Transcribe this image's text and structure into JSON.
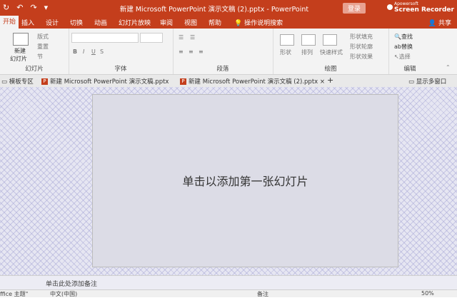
{
  "titlebar": {
    "title": "新建 Microsoft PowerPoint 演示文稿 (2).pptx  -  PowerPoint",
    "login": "登录",
    "recorder_line1": "Apowersoft",
    "recorder_line2": "Screen Recorder"
  },
  "tabs": [
    "开始",
    "插入",
    "设计",
    "切换",
    "动画",
    "幻灯片放映",
    "审阅",
    "视图",
    "帮助",
    "操作说明搜索"
  ],
  "share": "共享",
  "ribbon": {
    "slides": {
      "new_slide": "新建",
      "new_slide2": "幻灯片",
      "layout": "版式",
      "reset": "重置",
      "section": "节",
      "label": "幻灯片"
    },
    "font": {
      "label": "字体"
    },
    "paragraph": {
      "label": "段落"
    },
    "drawing": {
      "shape": "形状",
      "arrange": "排列",
      "quick_styles": "快速样式",
      "fill": "形状填充",
      "outline": "形状轮廓",
      "effects": "形状效果",
      "label": "绘图"
    },
    "editing": {
      "find": "查找",
      "replace": "替换",
      "select": "选择",
      "label": "编辑"
    }
  },
  "doctabs": {
    "template": "模板专区",
    "tab1": "新建 Microsoft PowerPoint 演示文稿.pptx",
    "tab2": "新建 Microsoft PowerPoint 演示文稿 (2).pptx",
    "add": "+",
    "show_window": "显示多窗口"
  },
  "slide": {
    "placeholder": "单击以添加第一张幻灯片"
  },
  "notes": {
    "placeholder": "单击此处添加备注"
  },
  "status": {
    "office": "ffice 主题\"",
    "lang": "中文(中国)",
    "notes": "备注",
    "zoom": "50%"
  },
  "colors": {
    "accent": "#c43e1c"
  }
}
